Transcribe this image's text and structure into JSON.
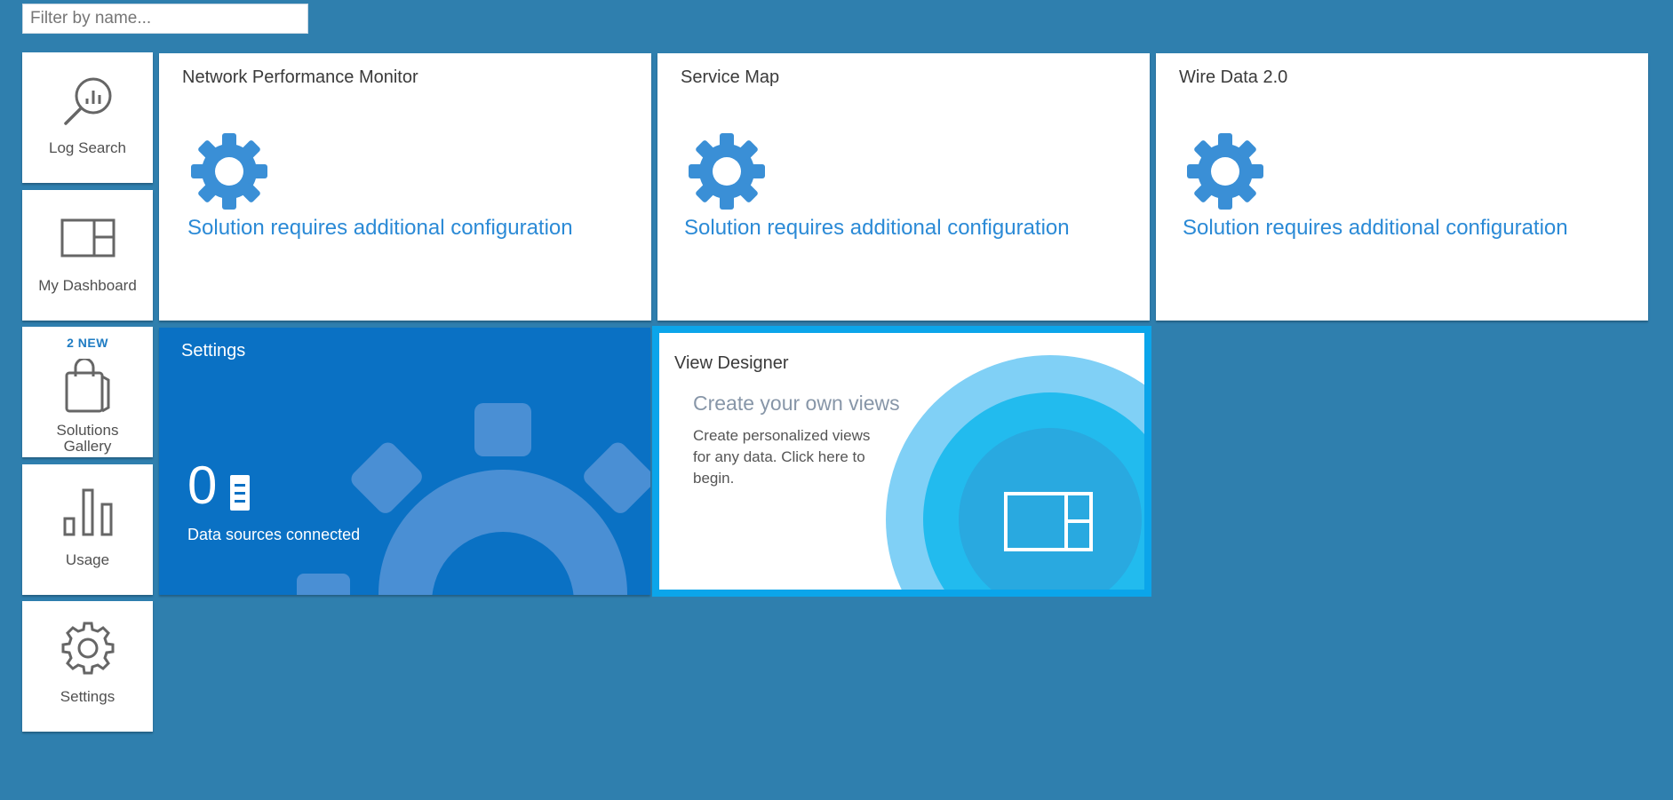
{
  "filter": {
    "placeholder": "Filter by name..."
  },
  "nav": [
    {
      "label": "Log Search",
      "icon": "magnifier-chart-icon"
    },
    {
      "label": "My Dashboard",
      "icon": "dashboard-layout-icon"
    },
    {
      "label": "Solutions Gallery",
      "label_line1": "Solutions",
      "label_line2": "Gallery",
      "badge": "2 NEW",
      "icon": "shopping-bag-icon"
    },
    {
      "label": "Usage",
      "icon": "bar-chart-icon"
    },
    {
      "label": "Settings",
      "icon": "gear-icon"
    }
  ],
  "solutions": [
    {
      "title": "Network Performance Monitor",
      "status": "Solution requires additional configuration"
    },
    {
      "title": "Service Map",
      "status": "Solution requires additional configuration"
    },
    {
      "title": "Wire Data 2.0",
      "status": "Solution requires additional configuration"
    }
  ],
  "settings_tile": {
    "title": "Settings",
    "count": "0",
    "subtitle": "Data sources connected"
  },
  "view_designer": {
    "title": "View Designer",
    "headline": "Create your own views",
    "description": "Create personalized views for any data. Click here to begin."
  },
  "colors": {
    "background": "#2f7fae",
    "accent_blue": "#2b8ad6",
    "settings_tile": "#0a71c4",
    "view_designer_border": "#0ba5ea"
  }
}
